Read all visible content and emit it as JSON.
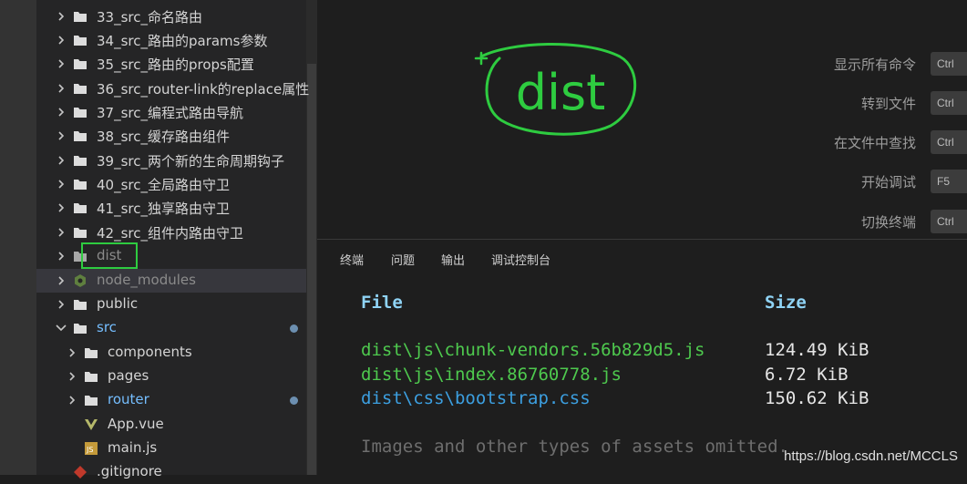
{
  "explorer": {
    "items": [
      {
        "label": "33_src_命名路由"
      },
      {
        "label": "34_src_路由的params参数"
      },
      {
        "label": "35_src_路由的props配置"
      },
      {
        "label": "36_src_router-link的replace属性"
      },
      {
        "label": "37_src_编程式路由导航"
      },
      {
        "label": "38_src_缓存路由组件"
      },
      {
        "label": "39_src_两个新的生命周期钩子"
      },
      {
        "label": "40_src_全局路由守卫"
      },
      {
        "label": "41_src_独享路由守卫"
      },
      {
        "label": "42_src_组件内路由守卫"
      },
      {
        "label": "dist"
      },
      {
        "label": "node_modules"
      },
      {
        "label": "public"
      },
      {
        "label": "src"
      },
      {
        "label": "components"
      },
      {
        "label": "pages"
      },
      {
        "label": "router"
      },
      {
        "label": "App.vue"
      },
      {
        "label": "main.js"
      },
      {
        "label": ".gitignore"
      }
    ]
  },
  "annotation": {
    "text": "dist",
    "color": "#2ecc40"
  },
  "commands": [
    {
      "label": "显示所有命令",
      "key": "Ctrl"
    },
    {
      "label": "转到文件",
      "key": "Ctrl"
    },
    {
      "label": "在文件中查找",
      "key": "Ctrl"
    },
    {
      "label": "开始调试",
      "key": "F5"
    },
    {
      "label": "切换终端",
      "key": "Ctrl"
    }
  ],
  "panel": {
    "tabs": [
      "终端",
      "问题",
      "输出",
      "调试控制台"
    ],
    "file_header": "File",
    "size_header": "Size",
    "rows": [
      {
        "file": "dist\\js\\chunk-vendors.56b829d5.js",
        "size": "124.49 KiB",
        "color": "#4ec94e"
      },
      {
        "file": "dist\\js\\index.86760778.js",
        "size": "6.72 KiB",
        "color": "#4ec94e"
      },
      {
        "file": "dist\\css\\bootstrap.css",
        "size": "150.62 KiB",
        "color": "#3c9fe0"
      }
    ],
    "footer": "Images and other types of assets omitted."
  },
  "watermark": "https://blog.csdn.net/MCCLS"
}
